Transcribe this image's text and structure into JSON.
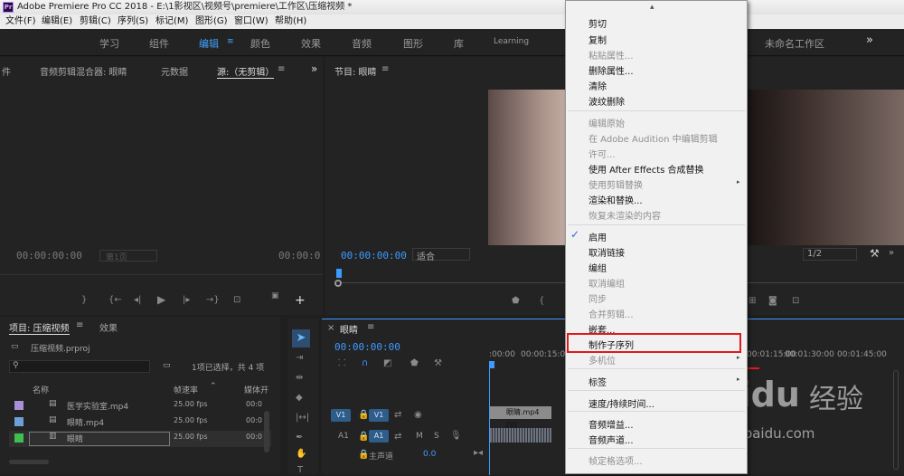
{
  "window": {
    "title": "Adobe Premiere Pro CC 2018 - E:\\1影视区\\视频号\\premiere\\工作区\\压缩视频 *",
    "logo": "Pr"
  },
  "menubar": [
    "文件(F)",
    "编辑(E)",
    "剪辑(C)",
    "序列(S)",
    "标记(M)",
    "图形(G)",
    "窗口(W)",
    "帮助(H)"
  ],
  "workspaces": {
    "items": [
      "学习",
      "组件",
      "编辑",
      "颜色",
      "效果",
      "音频",
      "图形",
      "库",
      "Learning"
    ],
    "active": "编辑",
    "right_label": "未命名工作区",
    "overflow": "»"
  },
  "source_panel": {
    "tabs": [
      "件",
      "音频剪辑混合器: 眼睛",
      "元数据",
      "源:（无剪辑）"
    ],
    "tc_left": "00:00:00:00",
    "page": "第1页",
    "tc_right": "00:00:0"
  },
  "program_panel": {
    "title": "节目: 眼睛",
    "tc": "00:00:00:00",
    "fit": "适合",
    "resolution": "1/2"
  },
  "project_panel": {
    "tabs": [
      "项目: 压缩视频",
      "效果"
    ],
    "file": "压缩视频.prproj",
    "selection_info": "1项已选择，共 4 项",
    "columns": [
      "名称",
      "帧速率",
      "媒体开"
    ],
    "rows": [
      {
        "name": "医学实验室.mp4",
        "fps": "25.00 fps",
        "media": "00:0",
        "color": "#a98fd6"
      },
      {
        "name": "眼睛.mp4",
        "fps": "25.00 fps",
        "media": "00:0",
        "color": "#6f9fd8"
      },
      {
        "name": "眼睛",
        "fps": "25.00 fps",
        "media": "00:0",
        "color": "#3fbf4f"
      }
    ]
  },
  "timeline": {
    "tab": "眼睛",
    "tc": "00:00:00:00",
    "ruler": [
      ":00:00",
      "00:00:15:00",
      "00:01:15:00",
      "00:01:30:00",
      "00:01:45:00"
    ],
    "tracks": {
      "v1_source": "V1",
      "v1": "V1",
      "a1_source": "A1",
      "a1": "A1",
      "m": "M",
      "s": "S",
      "master": "主声道",
      "master_value": "0.0"
    },
    "clip_video": "眼睛.mp4 [V]"
  },
  "context_menu": {
    "items": [
      {
        "label": "剪切",
        "enabled": true
      },
      {
        "label": "复制",
        "enabled": true
      },
      {
        "label": "粘贴属性...",
        "enabled": false
      },
      {
        "label": "删除属性...",
        "enabled": true
      },
      {
        "label": "清除",
        "enabled": true
      },
      {
        "label": "波纹删除",
        "enabled": true
      },
      {
        "label": "编辑原始",
        "enabled": false
      },
      {
        "label": "在 Adobe Audition 中编辑剪辑",
        "enabled": false
      },
      {
        "label": "许可...",
        "enabled": false
      },
      {
        "label": "使用 After Effects 合成替换",
        "enabled": true
      },
      {
        "label": "使用剪辑替换",
        "enabled": false,
        "submenu": true
      },
      {
        "label": "渲染和替换...",
        "enabled": true
      },
      {
        "label": "恢复未渲染的内容",
        "enabled": false
      },
      {
        "label": "启用",
        "enabled": true,
        "checked": true
      },
      {
        "label": "取消链接",
        "enabled": true
      },
      {
        "label": "编组",
        "enabled": true
      },
      {
        "label": "取消编组",
        "enabled": false
      },
      {
        "label": "同步",
        "enabled": false
      },
      {
        "label": "合并剪辑...",
        "enabled": false
      },
      {
        "label": "嵌套...",
        "enabled": true
      },
      {
        "label": "制作子序列",
        "enabled": true,
        "highlighted": true
      },
      {
        "label": "多机位",
        "enabled": false,
        "submenu": true
      },
      {
        "label": "标签",
        "enabled": true,
        "submenu": true
      },
      {
        "label": "速度/持续时间...",
        "enabled": true
      },
      {
        "label": "音频增益...",
        "enabled": true
      },
      {
        "label": "音频声道...",
        "enabled": true
      },
      {
        "label": "帧定格选项...",
        "enabled": false
      }
    ],
    "check_glyph": "✓",
    "submenu_glyph": "▸",
    "top_arrow": "▴"
  },
  "watermark": {
    "brand": "Baidu",
    "brand_cn": "经验",
    "url": "jingyan.baidu.com"
  }
}
